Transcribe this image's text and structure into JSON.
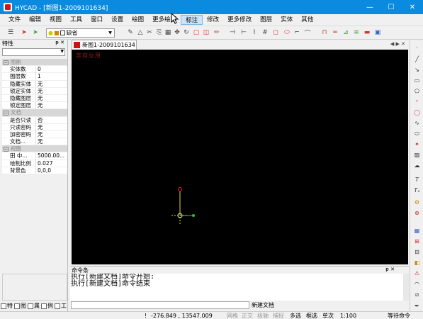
{
  "window": {
    "title": "HYCAD - [新图1-2009101634]",
    "controls": [
      "—",
      "☐",
      "✕"
    ]
  },
  "menu": [
    "文件",
    "编辑",
    "视图",
    "工具",
    "窗口",
    "设置",
    "绘图",
    "更多绘图",
    "标注",
    "修改",
    "更多修改",
    "图层",
    "实体",
    "其他"
  ],
  "toolbar": {
    "layer_value": "缺省"
  },
  "properties_panel": {
    "title": "特性",
    "rows": [
      {
        "type": "category",
        "label": "图副"
      },
      {
        "type": "prop",
        "key": "实体数",
        "value": "0"
      },
      {
        "type": "prop",
        "key": "图层数",
        "value": "1"
      },
      {
        "type": "prop",
        "key": "隐藏实体",
        "value": "无"
      },
      {
        "type": "prop",
        "key": "锁定实体",
        "value": "无"
      },
      {
        "type": "prop",
        "key": "隐藏图层",
        "value": "无"
      },
      {
        "type": "prop",
        "key": "锁定图层",
        "value": "无"
      },
      {
        "type": "category",
        "label": "文档"
      },
      {
        "type": "prop",
        "key": "是否只读",
        "value": "否"
      },
      {
        "type": "prop",
        "key": "只读密码",
        "value": "无"
      },
      {
        "type": "prop",
        "key": "加密密码",
        "value": "无"
      },
      {
        "type": "prop",
        "key": "文档...",
        "value": "无"
      },
      {
        "type": "category",
        "label": "视图"
      },
      {
        "type": "prop",
        "key": "田 中...",
        "value": "5000.00..."
      },
      {
        "type": "prop",
        "key": "绘制比例",
        "value": "0.027"
      },
      {
        "type": "prop",
        "key": "背景色",
        "value": "0,0,0"
      }
    ],
    "tabs": [
      "特",
      "图",
      "属",
      "例",
      "工"
    ]
  },
  "document": {
    "tab_label": "新图1-2009101634",
    "watermark": "非商业用"
  },
  "command": {
    "title": "命令条",
    "history": [
      "执行[新建文档]命令开始:",
      "执行[新建文档]命令结束"
    ],
    "last_label": "新建文档"
  },
  "status": {
    "mark": "!",
    "coords": "-276.849 , 13547.009",
    "toggles": [
      {
        "label": "网格",
        "on": false
      },
      {
        "label": "正交",
        "on": false
      },
      {
        "label": "极轴",
        "on": false
      },
      {
        "label": "捕捉",
        "on": false
      },
      {
        "label": "多选",
        "on": true
      },
      {
        "label": "框选",
        "on": true
      },
      {
        "label": "单次",
        "on": true
      }
    ],
    "scale": "1:100",
    "state": "等待命令"
  },
  "colors": {
    "titlebar": "#0b8be0",
    "canvas": "#000000",
    "ucs_x": "#2fbf2f",
    "ucs_y": "#d8d84a",
    "ucs_y_tip": "#e02020"
  }
}
